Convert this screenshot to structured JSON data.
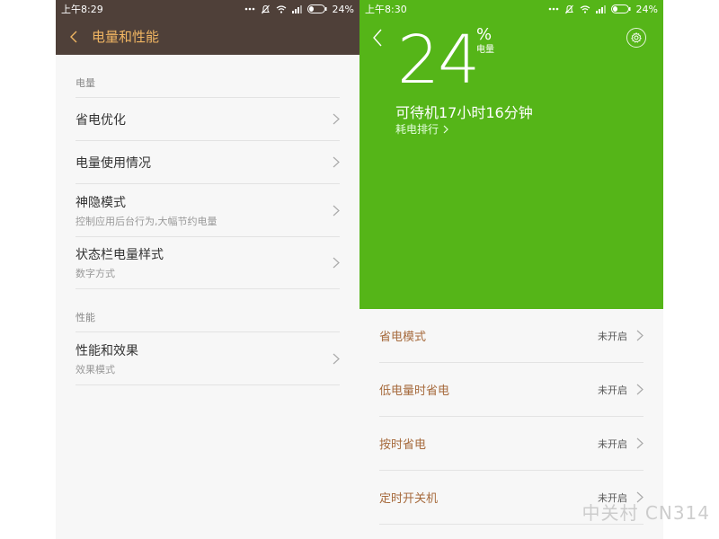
{
  "left": {
    "status": {
      "time": "上午8:29",
      "battery": "24%"
    },
    "title": "电量和性能",
    "sections": [
      {
        "header": "电量",
        "items": [
          {
            "main": "省电优化",
            "sub": ""
          },
          {
            "main": "电量使用情况",
            "sub": ""
          },
          {
            "main": "神隐模式",
            "sub": "控制应用后台行为,大幅节约电量"
          },
          {
            "main": "状态栏电量样式",
            "sub": "数字方式"
          }
        ]
      },
      {
        "header": "性能",
        "items": [
          {
            "main": "性能和效果",
            "sub": "效果模式"
          }
        ]
      }
    ]
  },
  "right": {
    "status": {
      "time": "上午8:30",
      "battery": "24%"
    },
    "battery_level": "24",
    "percent_sign": "%",
    "percent_label": "电量",
    "standby": "可待机17小时16分钟",
    "ranking": "耗电排行",
    "items": [
      {
        "label": "省电模式",
        "state": "未开启"
      },
      {
        "label": "低电量时省电",
        "state": "未开启"
      },
      {
        "label": "按时省电",
        "state": "未开启"
      },
      {
        "label": "定时开关机",
        "state": "未开启"
      }
    ]
  },
  "watermark": "中关村 CN314",
  "colors": {
    "left_header_bg": "#4f4039",
    "left_title": "#f0b562",
    "hero_green": "#55b518",
    "item_label_brown": "#a66a3c"
  }
}
